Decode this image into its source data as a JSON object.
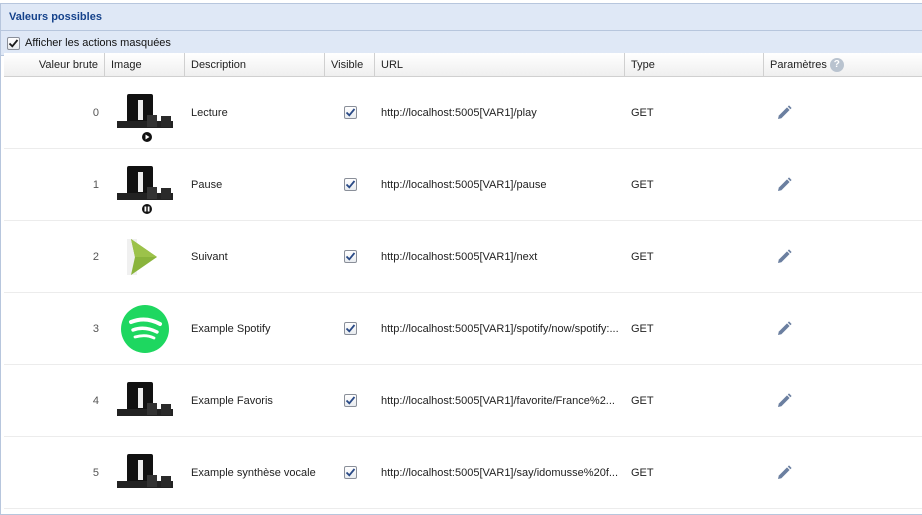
{
  "panel": {
    "title": "Valeurs possibles"
  },
  "toolbar": {
    "show_hidden_label": "Afficher les actions masquées",
    "show_hidden_checked": true
  },
  "columns": {
    "raw": "Valeur brute",
    "image": "Image",
    "description": "Description",
    "visible": "Visible",
    "url": "URL",
    "type": "Type",
    "params": "Paramètres"
  },
  "rows": [
    {
      "raw": "0",
      "image": "soundbar-play-icon",
      "description": "Lecture",
      "visible": true,
      "url": "http://localhost:5005[VAR1]/play",
      "type": "GET"
    },
    {
      "raw": "1",
      "image": "soundbar-pause-icon",
      "description": "Pause",
      "visible": true,
      "url": "http://localhost:5005[VAR1]/pause",
      "type": "GET"
    },
    {
      "raw": "2",
      "image": "next-arrow-icon",
      "description": "Suivant",
      "visible": true,
      "url": "http://localhost:5005[VAR1]/next",
      "type": "GET"
    },
    {
      "raw": "3",
      "image": "spotify-logo-icon",
      "description": "Example Spotify",
      "visible": true,
      "url": "http://localhost:5005[VAR1]/spotify/now/spotify:...",
      "type": "GET"
    },
    {
      "raw": "4",
      "image": "soundbar-icon",
      "description": "Example Favoris",
      "visible": true,
      "url": "http://localhost:5005[VAR1]/favorite/France%2...",
      "type": "GET"
    },
    {
      "raw": "5",
      "image": "soundbar-icon",
      "description": "Example synthèse vocale",
      "visible": true,
      "url": "http://localhost:5005[VAR1]/say/idomusse%20f...",
      "type": "GET"
    }
  ],
  "colors": {
    "header_bg": "#dfe8f6",
    "header_text": "#15428b",
    "spotify": "#1ed760",
    "arrow": "#8ab43c",
    "edit_icon": "#6b7fa0"
  }
}
